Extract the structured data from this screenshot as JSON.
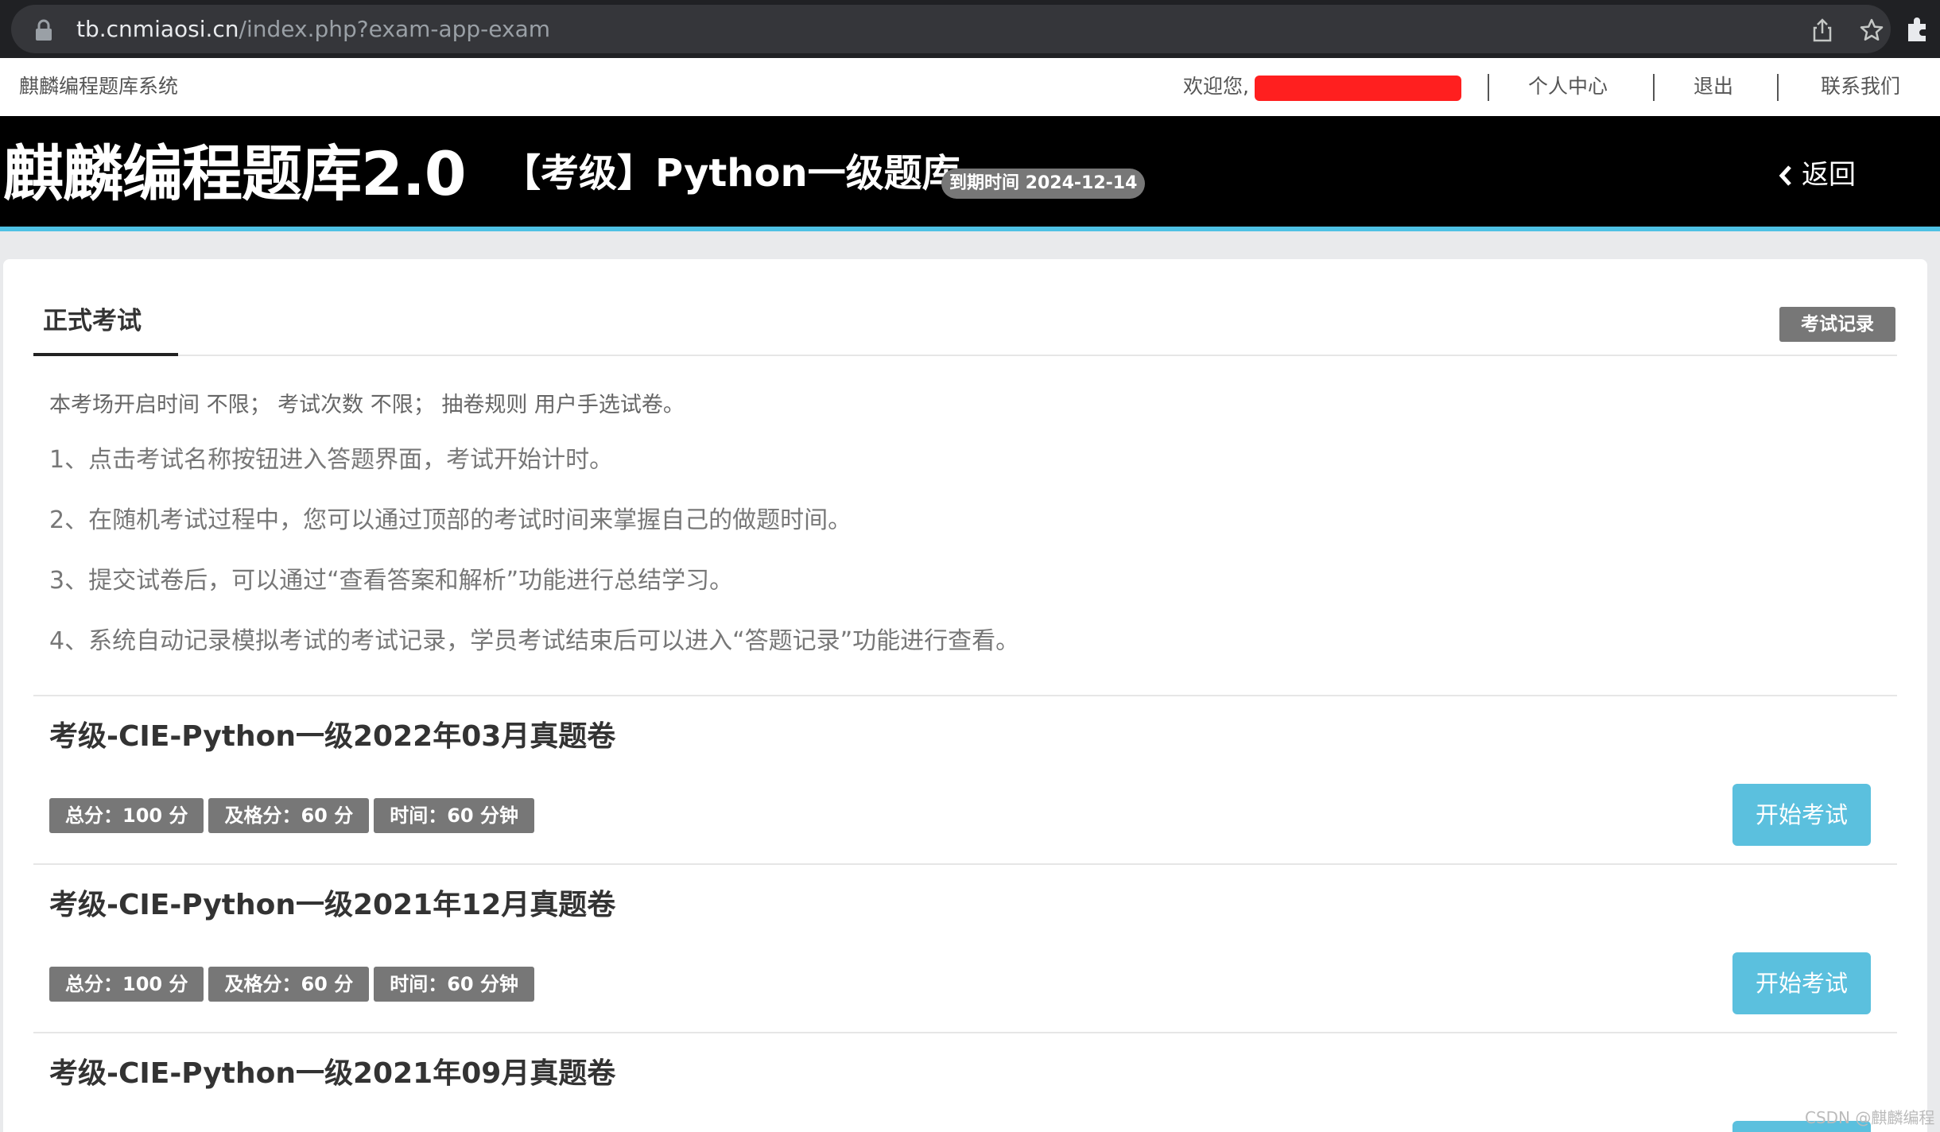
{
  "browser": {
    "url_host": "tb.cnmiaosi.cn",
    "url_path": "/index.php?exam-app-exam",
    "icons": [
      "lock-icon",
      "share-icon",
      "star-icon",
      "extensions-icon"
    ]
  },
  "topbar": {
    "site_name": "麒麟编程题库系统",
    "welcome": "欢迎您,",
    "nav": [
      "个人中心",
      "退出",
      "联系我们"
    ]
  },
  "header": {
    "brand": "麒麟编程题库2.0",
    "bank_title": "【考级】Python一级题库",
    "expiry": "到期时间 2024-12-14",
    "back": "返回"
  },
  "main": {
    "tab": "正式考试",
    "record_button": "考试记录",
    "info": "本考场开启时间 不限； 考试次数 不限； 抽卷规则 用户手选试卷。",
    "rules": [
      "1、点击考试名称按钮进入答题界面，考试开始计时。",
      "2、在随机考试过程中，您可以通过顶部的考试时间来掌握自己的做题时间。",
      "3、提交试卷后，可以通过“查看答案和解析”功能进行总结学习。",
      "4、系统自动记录模拟考试的考试记录，学员考试结束后可以进入“答题记录”功能进行查看。"
    ],
    "exams": [
      {
        "title": "考级-CIE-Python一级2022年03月真题卷",
        "total": "总分：100 分",
        "pass": "及格分：60 分",
        "time": "时间：60 分钟",
        "button": "开始考试"
      },
      {
        "title": "考级-CIE-Python一级2021年12月真题卷",
        "total": "总分：100 分",
        "pass": "及格分：60 分",
        "time": "时间：60 分钟",
        "button": "开始考试"
      },
      {
        "title": "考级-CIE-Python一级2021年09月真题卷"
      }
    ]
  },
  "watermark": "CSDN @麒麟编程",
  "colors": {
    "header_bg": "#000000",
    "accent": "#4ec1e4",
    "start_button": "#5bc0de",
    "tag_bg": "#777777",
    "redaction": "#ff1f1f"
  }
}
